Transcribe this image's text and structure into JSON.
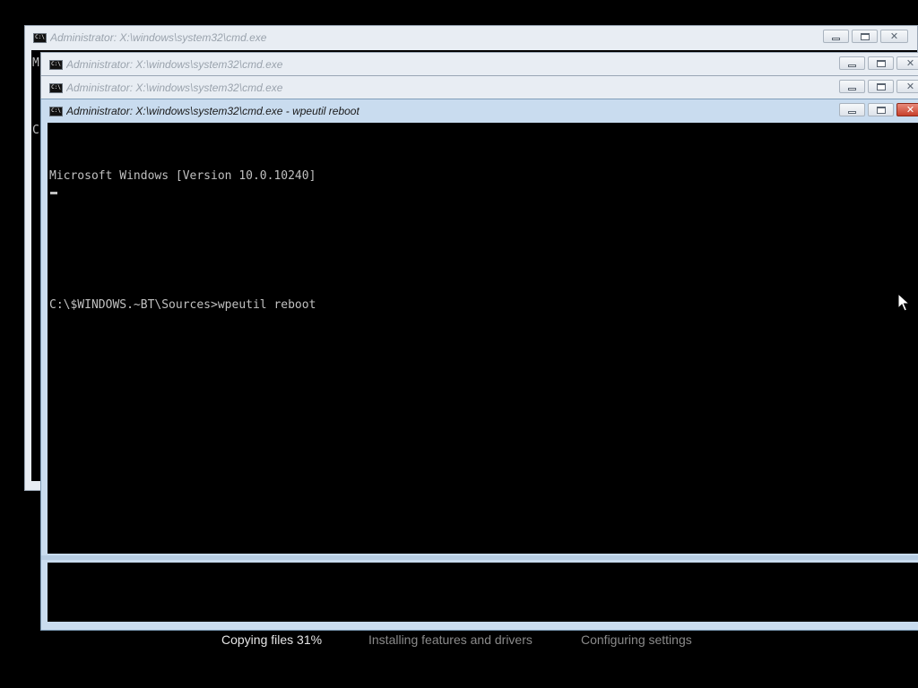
{
  "windows": [
    {
      "title": "Administrator: X:\\windows\\system32\\cmd.exe",
      "icon": "cmd-icon",
      "state": "inactive"
    },
    {
      "title": "Administrator: X:\\windows\\system32\\cmd.exe",
      "icon": "cmd-icon",
      "state": "inactive"
    },
    {
      "title": "Administrator: X:\\windows\\system32\\cmd.exe",
      "icon": "cmd-icon",
      "state": "inactive"
    },
    {
      "title": "Administrator: X:\\windows\\system32\\cmd.exe - wpeutil  reboot",
      "icon": "cmd-icon",
      "state": "active",
      "console": {
        "line1": "Microsoft Windows [Version 10.0.10240]",
        "line2": "",
        "line3": "C:\\$WINDOWS.~BT\\Sources>wpeutil reboot"
      }
    }
  ],
  "background_partial_chars": {
    "m": "M",
    "c": "C"
  },
  "icon_glyph": "C:\\",
  "setup_status": {
    "steps": [
      {
        "label": "Copying files 31%",
        "state": "current"
      },
      {
        "label": "Installing features and drivers",
        "state": "pending"
      },
      {
        "label": "Configuring settings",
        "state": "pending"
      }
    ]
  },
  "colors": {
    "desktop": "#000000",
    "console_bg": "#000000",
    "console_text": "#c0c0c0",
    "title_active": "#1a1a1a",
    "title_inactive": "#9aa3ad",
    "close_active": "#c7402b"
  }
}
